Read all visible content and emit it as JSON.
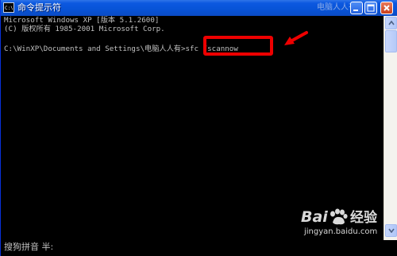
{
  "window": {
    "title": "命令提示符",
    "watermark_title": "电脑人人有"
  },
  "console": {
    "lines": [
      "Microsoft Windows XP [版本 5.1.2600]",
      "(C) 版权所有 1985-2001 Microsoft Corp."
    ],
    "prompt": "C:\\WinXP\\Documents and Settings\\电脑人人有>",
    "command": "sfc /scannow",
    "highlight_color": "#ee0000"
  },
  "ime": {
    "status_text": "搜狗拼音 半:"
  },
  "watermark": {
    "brand_bai": "Bai",
    "brand_jingyan": "经验",
    "url": "jingyan.baidu.com"
  },
  "icons": {
    "app": "cmd-icon",
    "minimize": "minimize-icon",
    "maximize": "maximize-icon",
    "close": "close-icon",
    "scroll_up": "chevron-up-icon",
    "scroll_down": "chevron-down-icon",
    "annotation": "arrow-icon",
    "paw": "baidu-paw-icon"
  }
}
